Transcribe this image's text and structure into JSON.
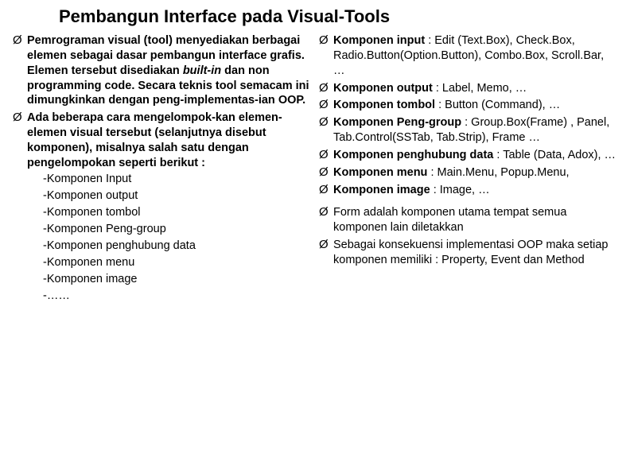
{
  "title": "Pembangun Interface pada Visual-Tools",
  "bullet_marker": "Ø",
  "left": {
    "b1_part1": "Pemrograman visual (tool) menyediakan berbagai elemen sebagai dasar pembangun interface grafis. Elemen tersebut disediakan ",
    "b1_builtin": "built-in",
    "b1_part2": " dan non programming code. Secara teknis tool semacam ini dimungkinkan dengan peng-implementas-ian OOP.",
    "b2": "Ada beberapa cara mengelompok-kan elemen-elemen visual tersebut (selanjutnya disebut komponen), misalnya salah satu dengan pengelompokan seperti berikut :",
    "subs": [
      "-Komponen Input",
      "-Komponen output",
      "-Komponen tombol",
      "-Komponen Peng-group",
      "-Komponen penghubung data",
      "-Komponen menu",
      "-Komponen image",
      "-……"
    ]
  },
  "right": {
    "r1_bold": "Komponen input ",
    "r1_rest": ": Edit (Text.Box), Check.Box, Radio.Button(Option.Button), Combo.Box, Scroll.Bar, …",
    "r2_bold": "Komponen output ",
    "r2_rest": ": Label, Memo, …",
    "r3_bold": "Komponen tombol ",
    "r3_rest": ": Button (Command), …",
    "r4_bold": "Komponen Peng-group ",
    "r4_rest": ": Group.Box(Frame) , Panel, Tab.Control(SSTab, Tab.Strip), Frame …",
    "r5_bold": "Komponen penghubung data ",
    "r5_rest": ": Table (Data, Adox), …",
    "r6_bold": "Komponen menu ",
    "r6_rest": ": Main.Menu, Popup.Menu,",
    "r7_bold": "Komponen image ",
    "r7_rest": ": Image, …",
    "r8": "Form adalah komponen utama tempat semua komponen lain diletakkan",
    "r9": "Sebagai konsekuensi implementasi OOP maka setiap komponen memiliki : Property, Event dan Method"
  }
}
